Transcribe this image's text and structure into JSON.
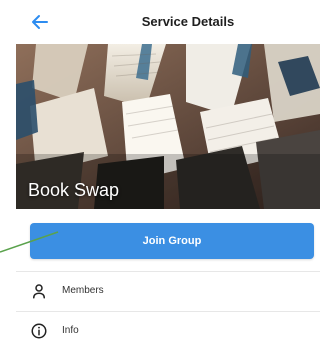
{
  "header": {
    "title": "Service Details",
    "back_icon": "arrow-left-icon"
  },
  "hero": {
    "label": "Book Swap"
  },
  "actions": {
    "join_label": "Join Group"
  },
  "menu": {
    "items": [
      {
        "label": "Members",
        "icon": "user-icon"
      },
      {
        "label": "Info",
        "icon": "info-icon"
      }
    ]
  },
  "colors": {
    "accent": "#3b8fe3",
    "annotation": "#5aa24c"
  }
}
